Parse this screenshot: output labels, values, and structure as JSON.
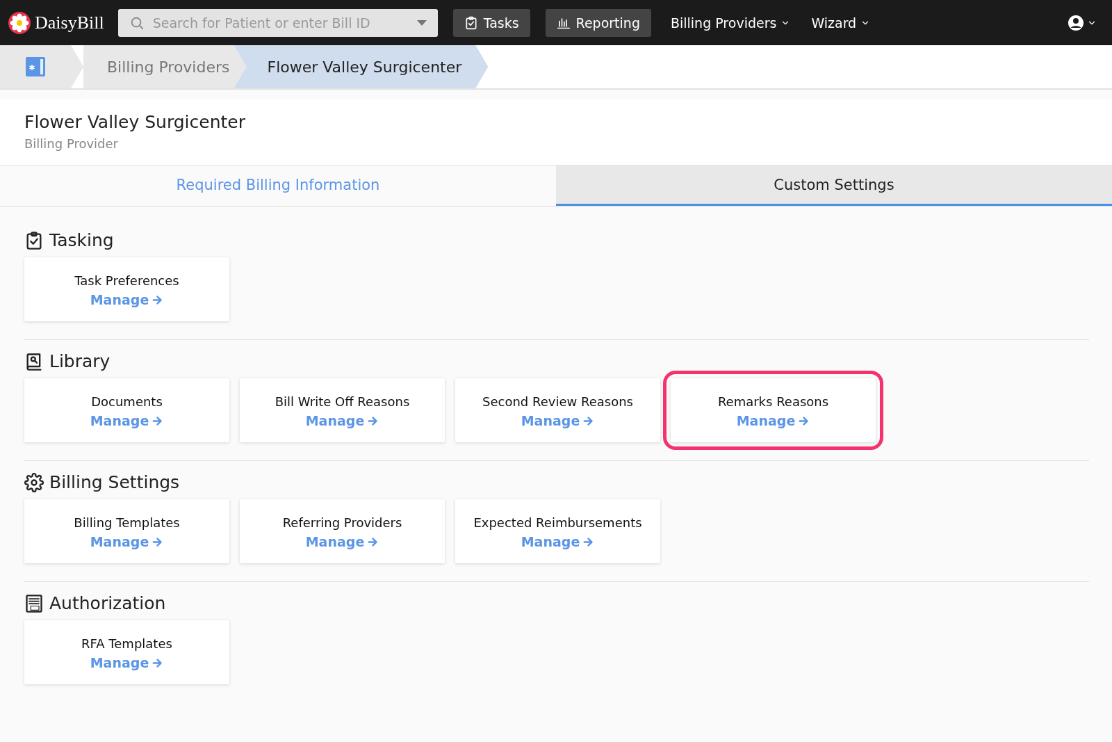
{
  "navbar": {
    "logo": "DaisyBill",
    "search": {
      "placeholder": "Search for Patient or enter Bill ID"
    },
    "buttons": [
      {
        "kind": "tasks",
        "label": "Tasks"
      },
      {
        "kind": "reporting",
        "label": "Reporting"
      }
    ],
    "menus": [
      {
        "label": "Billing Providers"
      },
      {
        "label": "Wizard"
      }
    ]
  },
  "breadcrumb": [
    {
      "label": "Billing Providers",
      "selected": false
    },
    {
      "label": "Flower Valley Surgicenter",
      "selected": true
    }
  ],
  "header": {
    "title": "Flower Valley Surgicenter",
    "subtitle": "Billing Provider"
  },
  "tabs": [
    {
      "label": "Required Billing Information",
      "selected": false
    },
    {
      "label": "Custom Settings",
      "selected": true
    }
  ],
  "sections": [
    {
      "kind": "tasking",
      "title": "Tasking",
      "cards": [
        {
          "title": "Task Preferences",
          "link": "Manage",
          "highlighted": false
        }
      ]
    },
    {
      "kind": "library",
      "title": "Library",
      "cards": [
        {
          "title": "Documents",
          "link": "Manage",
          "highlighted": false
        },
        {
          "title": "Bill Write Off Reasons",
          "link": "Manage",
          "highlighted": false
        },
        {
          "title": "Second Review Reasons",
          "link": "Manage",
          "highlighted": false
        },
        {
          "title": "Remarks Reasons",
          "link": "Manage",
          "highlighted": true
        }
      ]
    },
    {
      "kind": "settings",
      "title": "Billing Settings",
      "cards": [
        {
          "title": "Billing Templates",
          "link": "Manage",
          "highlighted": false
        },
        {
          "title": "Referring Providers",
          "link": "Manage",
          "highlighted": false
        },
        {
          "title": "Expected Reimbursements",
          "link": "Manage",
          "highlighted": false
        }
      ]
    },
    {
      "kind": "authorization",
      "title": "Authorization",
      "cards": [
        {
          "title": "RFA Templates",
          "link": "Manage",
          "highlighted": false
        }
      ]
    }
  ]
}
